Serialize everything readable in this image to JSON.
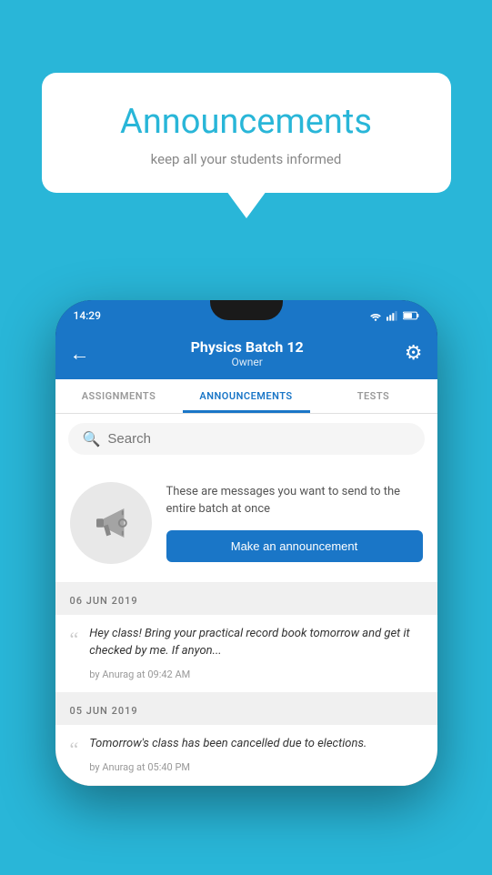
{
  "background_color": "#29b6d8",
  "speech_bubble": {
    "title": "Announcements",
    "subtitle": "keep all your students informed"
  },
  "phone": {
    "status_bar": {
      "time": "14:29"
    },
    "header": {
      "batch_name": "Physics Batch 12",
      "owner_label": "Owner"
    },
    "tabs": [
      {
        "label": "ASSIGNMENTS",
        "active": false
      },
      {
        "label": "ANNOUNCEMENTS",
        "active": true
      },
      {
        "label": "TESTS",
        "active": false
      }
    ],
    "search": {
      "placeholder": "Search"
    },
    "promo": {
      "description": "These are messages you want to send to the entire batch at once",
      "button_label": "Make an announcement"
    },
    "announcements": [
      {
        "date": "06 JUN 2019",
        "text": "Hey class! Bring your practical record book tomorrow and get it checked by me. If anyon...",
        "by_line": "by Anurag at 09:42 AM"
      },
      {
        "date": "05 JUN 2019",
        "text": "Tomorrow's class has been cancelled due to elections.",
        "by_line": "by Anurag at 05:40 PM"
      }
    ]
  }
}
